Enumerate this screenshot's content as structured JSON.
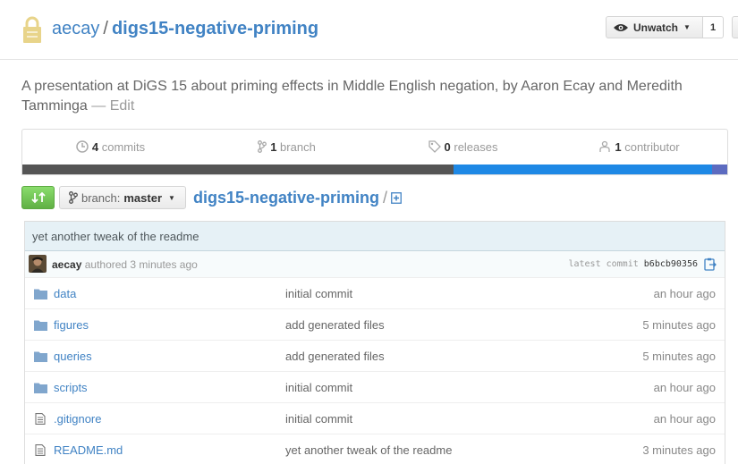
{
  "repo": {
    "owner": "aecay",
    "separator": "/",
    "name": "digs15-negative-priming"
  },
  "watch": {
    "label": "Unwatch",
    "count": "1"
  },
  "description": {
    "text": "A presentation at DiGS 15 about priming effects in Middle English negation, by Aaron Ecay and Meredith Tamminga",
    "edit_label": "— Edit"
  },
  "summary": {
    "commits_count": "4",
    "commits_label": "commits",
    "branches_count": "1",
    "branches_label": "branch",
    "releases_count": "0",
    "releases_label": "releases",
    "contributors_count": "1",
    "contributors_label": "contributor"
  },
  "languages": [
    {
      "color": "#555555",
      "percent": 61
    },
    {
      "color": "#1e88e5",
      "percent": 36.6
    },
    {
      "color": "#5c6bc0",
      "percent": 2.4
    }
  ],
  "branch_selector": {
    "prefix": "branch:",
    "value": "master"
  },
  "breadcrumb": {
    "root": "digs15-negative-priming",
    "separator": "/"
  },
  "latest_commit": {
    "message": "yet another tweak of the readme",
    "author": "aecay",
    "authored_text": "authored 3 minutes ago",
    "label": "latest commit",
    "sha": "b6bcb90356"
  },
  "files": [
    {
      "type": "folder",
      "name": "data",
      "message": "initial commit",
      "age": "an hour ago"
    },
    {
      "type": "folder",
      "name": "figures",
      "message": "add generated files",
      "age": "5 minutes ago"
    },
    {
      "type": "folder",
      "name": "queries",
      "message": "add generated files",
      "age": "5 minutes ago"
    },
    {
      "type": "folder",
      "name": "scripts",
      "message": "initial commit",
      "age": "an hour ago"
    },
    {
      "type": "file",
      "name": ".gitignore",
      "message": "initial commit",
      "age": "an hour ago"
    },
    {
      "type": "file",
      "name": "README.md",
      "message": "yet another tweak of the readme",
      "age": "3 minutes ago"
    }
  ],
  "colors": {
    "link": "#4183c4",
    "compare_green": "#60b044",
    "commit_bg": "#e6f1f6"
  }
}
